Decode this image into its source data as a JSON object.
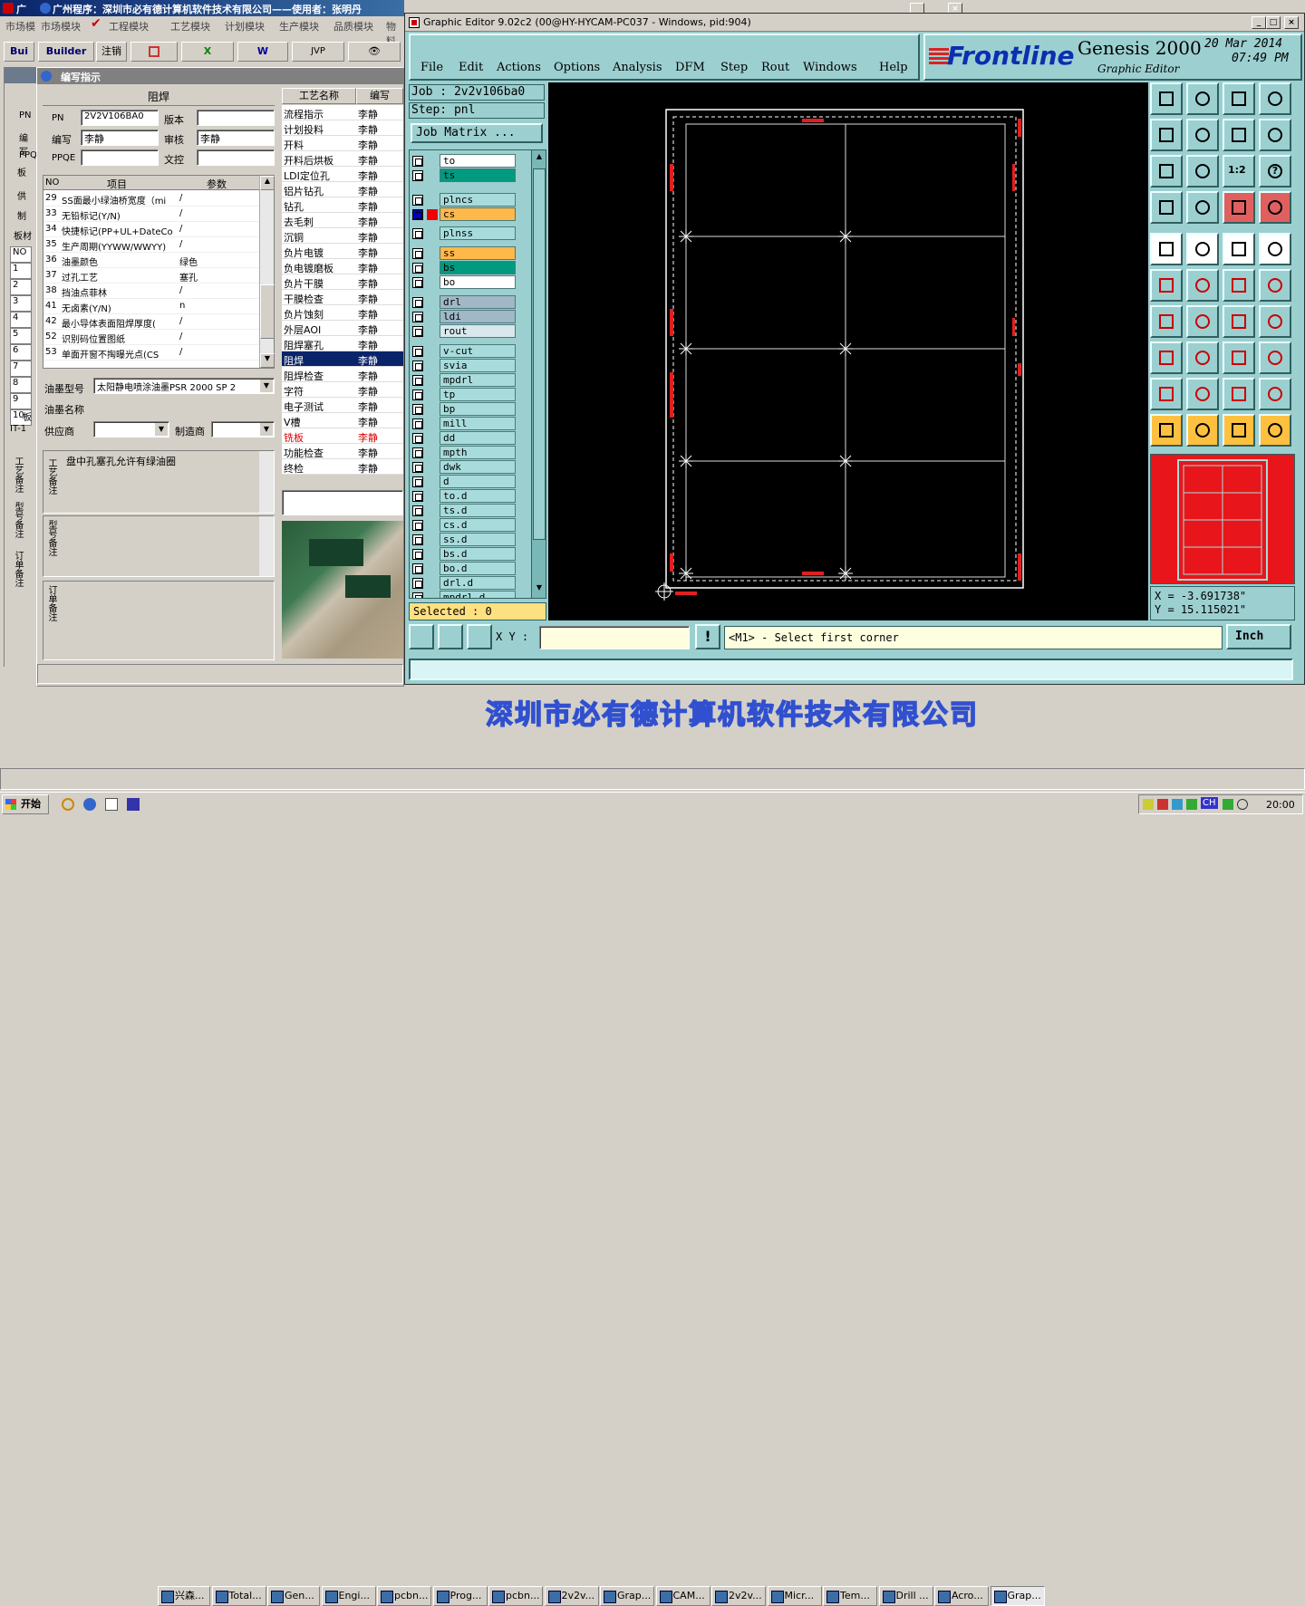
{
  "left_app": {
    "title": "广州程序：深圳市必有德计算机软件技术有限公司——使用者：张明丹",
    "title_prefix": "广",
    "menu": [
      "市场模块",
      "工程模块",
      "工艺模块",
      "计划模块",
      "生产模块",
      "品质模块",
      "物料"
    ],
    "menu_prefix": "市场模",
    "toolbar": {
      "builder": "Builder",
      "logout": "注销",
      "jvp": "JVP",
      "bui": "Bui"
    },
    "sub_title": "编写指示",
    "sub_prefix": "指",
    "section_title": "阻焊",
    "fields": {
      "pn_label": "PN",
      "pn_value": "2V2V106BA0",
      "version_label": "版本",
      "version_value": "",
      "writer_label": "编写",
      "writer_value": "李静",
      "review_label": "审核",
      "review_value": "李静",
      "ppqe_label": "PPQE",
      "ppqe_value": "",
      "doc_label": "文控",
      "doc_value": ""
    },
    "left_labels": [
      "PN",
      "编写",
      "PPQ",
      "板",
      "供",
      "制",
      "板材"
    ],
    "table_headers": {
      "no": "NO",
      "item": "项目",
      "param": "参数"
    },
    "table_rows": [
      {
        "no": "29",
        "item": "SS面最小绿油桥宽度（mi",
        "param": "/"
      },
      {
        "no": "33",
        "item": "无铅标记(Y/N)",
        "param": "/"
      },
      {
        "no": "34",
        "item": "快捷标记(PP+UL+DateCo",
        "param": "/"
      },
      {
        "no": "35",
        "item": "生产周期(YYWW/WWYY)",
        "param": "/"
      },
      {
        "no": "36",
        "item": "油墨颜色",
        "param": "绿色"
      },
      {
        "no": "37",
        "item": "过孔工艺",
        "param": "塞孔"
      },
      {
        "no": "38",
        "item": "挡油点菲林",
        "param": "/"
      },
      {
        "no": "41",
        "item": "无卤素(Y/N)",
        "param": "n"
      },
      {
        "no": "42",
        "item": "最小导体表面阻焊厚度(",
        "param": "/"
      },
      {
        "no": "52",
        "item": "识别码位置图纸",
        "param": "/"
      },
      {
        "no": "53",
        "item": "单面开窗不掏曝光点(CS",
        "param": "/"
      }
    ],
    "ink_type_label": "油墨型号",
    "ink_type_value": "太阳静电喷涂油墨PSR 2000 SP 2",
    "ink_name_label": "油墨名称",
    "supplier_label": "供应商",
    "maker_label": "制造商",
    "note_label_process": "工艺备注",
    "note_process_text": "盘中孔塞孔允许有绿油圈",
    "note_label_model": "型号备注",
    "note_label_order": "订单备注",
    "side_tabs": [
      "工艺备注",
      "型号备注",
      "订单备注"
    ],
    "outer_rows": [
      "NO",
      "1",
      "2",
      "3",
      "4",
      "5",
      "6",
      "7",
      "8",
      "9",
      "10"
    ],
    "outer_it": "IT-1",
    "outer_ban": "板"
  },
  "process_list": {
    "headers": {
      "name": "工艺名称",
      "writer": "编写"
    },
    "rows": [
      {
        "name": "流程指示",
        "writer": "李静"
      },
      {
        "name": "计划投料",
        "writer": "李静"
      },
      {
        "name": "开料",
        "writer": "李静"
      },
      {
        "name": "开料后烘板",
        "writer": "李静"
      },
      {
        "name": "LDI定位孔",
        "writer": "李静"
      },
      {
        "name": "铝片钻孔",
        "writer": "李静"
      },
      {
        "name": "钻孔",
        "writer": "李静"
      },
      {
        "name": "去毛刺",
        "writer": "李静"
      },
      {
        "name": "沉铜",
        "writer": "李静"
      },
      {
        "name": "负片电镀",
        "writer": "李静"
      },
      {
        "name": "负电镀磨板",
        "writer": "李静"
      },
      {
        "name": "负片干膜",
        "writer": "李静"
      },
      {
        "name": "干膜检查",
        "writer": "李静"
      },
      {
        "name": "负片蚀刻",
        "writer": "李静"
      },
      {
        "name": "外层AOI",
        "writer": "李静"
      },
      {
        "name": "阻焊塞孔",
        "writer": "李静"
      },
      {
        "name": "阻焊",
        "writer": "李静"
      },
      {
        "name": "阻焊检查",
        "writer": "李静"
      },
      {
        "name": "字符",
        "writer": "李静"
      },
      {
        "name": "电子测试",
        "writer": "李静"
      },
      {
        "name": "V槽",
        "writer": "李静"
      },
      {
        "name": "铣板",
        "writer": "李静"
      },
      {
        "name": "功能检查",
        "writer": "李静"
      },
      {
        "name": "终检",
        "writer": "李静"
      }
    ]
  },
  "genesis": {
    "title": "Graphic Editor 9.02c2 (00@HY-HYCAM-PC037 - Windows, pid:904)",
    "menu": [
      "File",
      "Edit",
      "Actions",
      "Options",
      "Analysis",
      "DFM",
      "Step",
      "Rout",
      "Windows",
      "Help"
    ],
    "brand": "Frontline",
    "product": "Genesis 2000",
    "subtitle": "Graphic Editor",
    "date": "20 Mar 2014",
    "time": "07:49 PM",
    "job": "Job : 2v2v106ba0",
    "step": "Step: pnl",
    "job_matrix": "Job Matrix ...",
    "layers": [
      {
        "name": "to",
        "color": "#ffffff"
      },
      {
        "name": "ts",
        "color": "#009a80"
      },
      {
        "name": "plncs",
        "color": "#a8dcdc"
      },
      {
        "name": "cs",
        "color": "#ffb84a"
      },
      {
        "name": "plnss",
        "color": "#a8dcdc"
      },
      {
        "name": "ss",
        "color": "#ffb84a"
      },
      {
        "name": "bs",
        "color": "#009a80"
      },
      {
        "name": "bo",
        "color": "#ffffff"
      },
      {
        "name": "drl",
        "color": "#a0b8c8"
      },
      {
        "name": "ldi",
        "color": "#a0b8c8"
      },
      {
        "name": "rout",
        "color": "#d8e8ec"
      },
      {
        "name": "v-cut",
        "color": "#a8dcdc"
      },
      {
        "name": "svia",
        "color": "#a8dcdc"
      },
      {
        "name": "mpdrl",
        "color": "#a8dcdc"
      },
      {
        "name": "tp",
        "color": "#a8dcdc"
      },
      {
        "name": "bp",
        "color": "#a8dcdc"
      },
      {
        "name": "mill",
        "color": "#a8dcdc"
      },
      {
        "name": "dd",
        "color": "#a8dcdc"
      },
      {
        "name": "mpth",
        "color": "#a8dcdc"
      },
      {
        "name": "dwk",
        "color": "#a8dcdc"
      },
      {
        "name": "d",
        "color": "#a8dcdc"
      },
      {
        "name": "to.d",
        "color": "#a8dcdc"
      },
      {
        "name": "ts.d",
        "color": "#a8dcdc"
      },
      {
        "name": "cs.d",
        "color": "#a8dcdc"
      },
      {
        "name": "ss.d",
        "color": "#a8dcdc"
      },
      {
        "name": "bs.d",
        "color": "#a8dcdc"
      },
      {
        "name": "bo.d",
        "color": "#a8dcdc"
      },
      {
        "name": "drl.d",
        "color": "#a8dcdc"
      },
      {
        "name": "mpdrl.d",
        "color": "#a8dcdc"
      }
    ],
    "selected": "Selected : 0",
    "xy_label": "X Y :",
    "xy_value": "",
    "prompt": "<M1> - Select first corner",
    "units": "Inch",
    "coord_x": "X = -3.691738\"",
    "coord_y": "Y = 15.115021\"",
    "canvas_bg": "#000000",
    "panel_bg": "#9ccfd0"
  },
  "watermark": "深圳市必有德计算机软件技术有限公司",
  "taskbar": {
    "start": "开始",
    "tasks": [
      "兴森...",
      "Total...",
      "Gen...",
      "Engi...",
      "pcbn...",
      "Prog...",
      "pcbn...",
      "2v2v...",
      "Grap...",
      "CAM...",
      "2v2v...",
      "Micr...",
      "Tem...",
      "Drill ...",
      "Acro...",
      "Grap..."
    ],
    "ime": "CH",
    "clock": "20:00"
  }
}
